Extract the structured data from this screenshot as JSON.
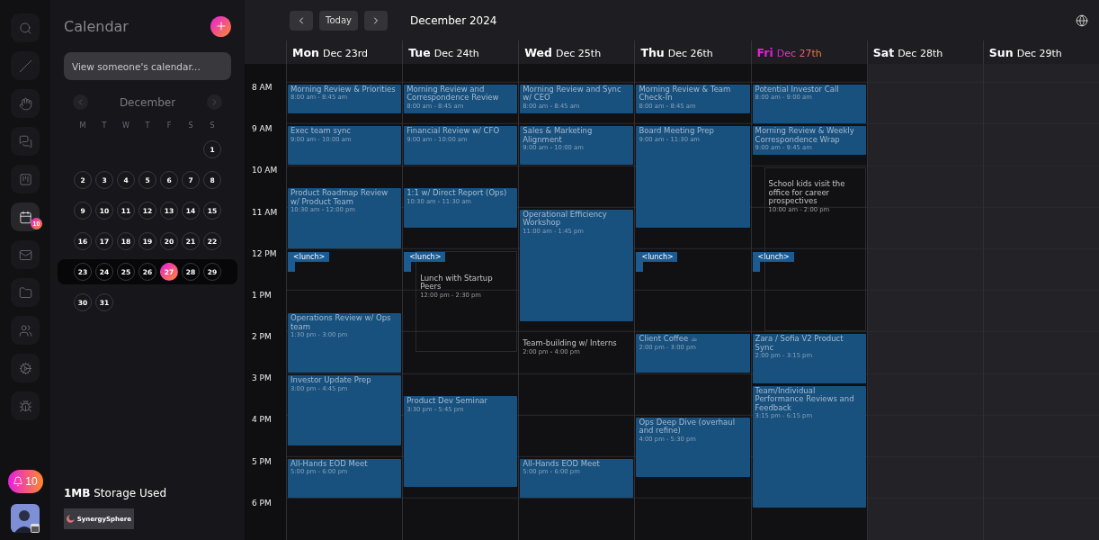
{
  "rail": {
    "items": [
      {
        "selected": false
      },
      {
        "selected": false
      },
      {
        "selected": false
      },
      {
        "selected": false
      },
      {
        "selected": false
      },
      {
        "selected": true,
        "badge": "10"
      },
      {
        "selected": false
      },
      {
        "selected": false
      },
      {
        "selected": false
      },
      {
        "selected": false
      },
      {
        "selected": false
      }
    ],
    "notifications": "10"
  },
  "panel": {
    "title": "Calendar",
    "search": {
      "placeholder": "View someone's calendar..."
    },
    "mini_calendar": {
      "month": "December",
      "weekdays": [
        "M",
        "T",
        "W",
        "T",
        "F",
        "S",
        "S"
      ],
      "weeks": [
        {
          "current": false,
          "days": [
            {
              "label": "1",
              "selected": false
            }
          ]
        },
        {
          "current": false,
          "days": [
            {
              "label": "2",
              "selected": false
            },
            {
              "label": "3",
              "selected": false
            },
            {
              "label": "4",
              "selected": false
            },
            {
              "label": "5",
              "selected": false
            },
            {
              "label": "6",
              "selected": false
            },
            {
              "label": "7",
              "selected": false
            },
            {
              "label": "8",
              "selected": false
            }
          ]
        },
        {
          "current": false,
          "days": [
            {
              "label": "9",
              "selected": false
            },
            {
              "label": "10",
              "selected": false
            },
            {
              "label": "11",
              "selected": false
            },
            {
              "label": "12",
              "selected": false
            },
            {
              "label": "13",
              "selected": false
            },
            {
              "label": "14",
              "selected": false
            },
            {
              "label": "15",
              "selected": false
            }
          ]
        },
        {
          "current": false,
          "days": [
            {
              "label": "16",
              "selected": false
            },
            {
              "label": "17",
              "selected": false
            },
            {
              "label": "18",
              "selected": false
            },
            {
              "label": "19",
              "selected": false
            },
            {
              "label": "20",
              "selected": false
            },
            {
              "label": "21",
              "selected": false
            },
            {
              "label": "22",
              "selected": false
            }
          ]
        },
        {
          "current": true,
          "days": [
            {
              "label": "23",
              "selected": false
            },
            {
              "label": "24",
              "selected": false
            },
            {
              "label": "25",
              "selected": false
            },
            {
              "label": "26",
              "selected": false
            },
            {
              "label": "27",
              "selected": true
            },
            {
              "label": "28",
              "selected": false
            },
            {
              "label": "29",
              "selected": false
            }
          ]
        },
        {
          "current": false,
          "days": [
            {
              "label": "30",
              "selected": false
            },
            {
              "label": "31",
              "selected": false
            }
          ]
        }
      ]
    },
    "storage": "**1MB** Storage Used",
    "brand": "SynergySphere"
  },
  "toolbar": {
    "today": "Today",
    "title": "December 2024"
  },
  "times": [
    "8 AM",
    "9 AM",
    "10 AM",
    "11 AM",
    "12 PM",
    "1 PM",
    "2 PM",
    "3 PM",
    "4 PM",
    "5 PM",
    "6 PM"
  ],
  "days": [
    {
      "name": "Mon",
      "date": "Dec 23rd",
      "today": false,
      "weekend": false,
      "lunch": "<lunch>",
      "events": [
        {
          "kind": "meeting",
          "title": "Morning Review & Priorities",
          "time": "8:00 am - 8:45 am"
        },
        {
          "kind": "meeting",
          "title": "Exec team sync",
          "time": "9:00 am - 10:00 am"
        },
        {
          "kind": "meeting",
          "title": "Product Roadmap Review w/ Product Team",
          "time": "10:30 am - 12:00 pm"
        },
        {
          "kind": "meeting",
          "title": "Operations Review w/ Ops team",
          "time": "1:30 pm - 3:00 pm"
        },
        {
          "kind": "meeting",
          "title": "Investor Update Prep",
          "time": "3:00 pm - 4:45 pm"
        },
        {
          "kind": "meeting",
          "title": "All-Hands EOD Meet",
          "time": "5:00 pm - 6:00 pm"
        }
      ]
    },
    {
      "name": "Tue",
      "date": "Dec 24th",
      "today": false,
      "weekend": false,
      "lunch": "<lunch>",
      "events": [
        {
          "kind": "meeting",
          "title": "Morning Review and Correspondence Review",
          "time": "8:00 am - 8:45 am"
        },
        {
          "kind": "meeting",
          "title": "Financial Review w/ CFO",
          "time": "9:00 am - 10:00 am"
        },
        {
          "kind": "meeting",
          "title": "1:1 w/ Direct Report (Ops)",
          "time": "10:30 am - 11:30 am"
        },
        {
          "kind": "outline",
          "title": "Lunch with Startup Peers",
          "time": "12:00 pm - 2:30 pm"
        },
        {
          "kind": "meeting",
          "title": "Product Dev Seminar",
          "time": "3:30 pm - 5:45 pm"
        }
      ]
    },
    {
      "name": "Wed",
      "date": "Dec 25th",
      "today": false,
      "weekend": false,
      "events": [
        {
          "kind": "meeting",
          "title": "Morning Review and Sync w/ CEO",
          "time": "8:00 am - 8:45 am"
        },
        {
          "kind": "meeting",
          "title": "Sales & Marketing Alignment",
          "time": "9:00 am - 10:00 am"
        },
        {
          "kind": "meeting",
          "title": "Operational Efficiency Workshop",
          "time": "11:00 am - 1:45 pm"
        },
        {
          "kind": "plain",
          "title": "Team-building w/ Interns",
          "time": "2:00 pm - 4:00 pm"
        },
        {
          "kind": "meeting",
          "title": "All-Hands EOD Meet",
          "time": "5:00 pm - 6:00 pm"
        }
      ]
    },
    {
      "name": "Thu",
      "date": "Dec 26th",
      "today": false,
      "weekend": false,
      "lunch": "<lunch>",
      "events": [
        {
          "kind": "meeting",
          "title": "Morning Review & Team Check-In",
          "time": "8:00 am - 8:45 am"
        },
        {
          "kind": "meeting",
          "title": "Board Meeting Prep",
          "time": "9:00 am - 11:30 am"
        },
        {
          "kind": "meeting",
          "title": "Client Coffee ☕",
          "time": "2:00 pm - 3:00 pm"
        },
        {
          "kind": "meeting",
          "title": "Ops Deep Dive (overhaul and refine)",
          "time": "4:00 pm - 5:30 pm"
        }
      ]
    },
    {
      "name": "Fri",
      "date": "Dec 27th",
      "today": true,
      "weekend": false,
      "lunch": "<lunch>",
      "events": [
        {
          "kind": "meeting",
          "title": "Potential Investor Call",
          "time": "8:00 am - 9:00 am"
        },
        {
          "kind": "meeting",
          "title": "Morning Review & Weekly Correspondence Wrap",
          "time": "9:00 am - 9:45 am"
        },
        {
          "kind": "outline",
          "title": "School kids visit the office for career prospectives",
          "time": "10:00 am - 2:00 pm"
        },
        {
          "kind": "meeting",
          "title": "Zara / Sofia V2 Product Sync",
          "time": "2:00 pm - 3:15 pm"
        },
        {
          "kind": "meeting",
          "title": "Team/Individual Performance Reviews and Feedback",
          "time": "3:15 pm - 6:15 pm"
        }
      ]
    },
    {
      "name": "Sat",
      "date": "Dec 28th",
      "today": false,
      "weekend": true
    },
    {
      "name": "Sun",
      "date": "Dec 29th",
      "today": false,
      "weekend": true
    }
  ]
}
